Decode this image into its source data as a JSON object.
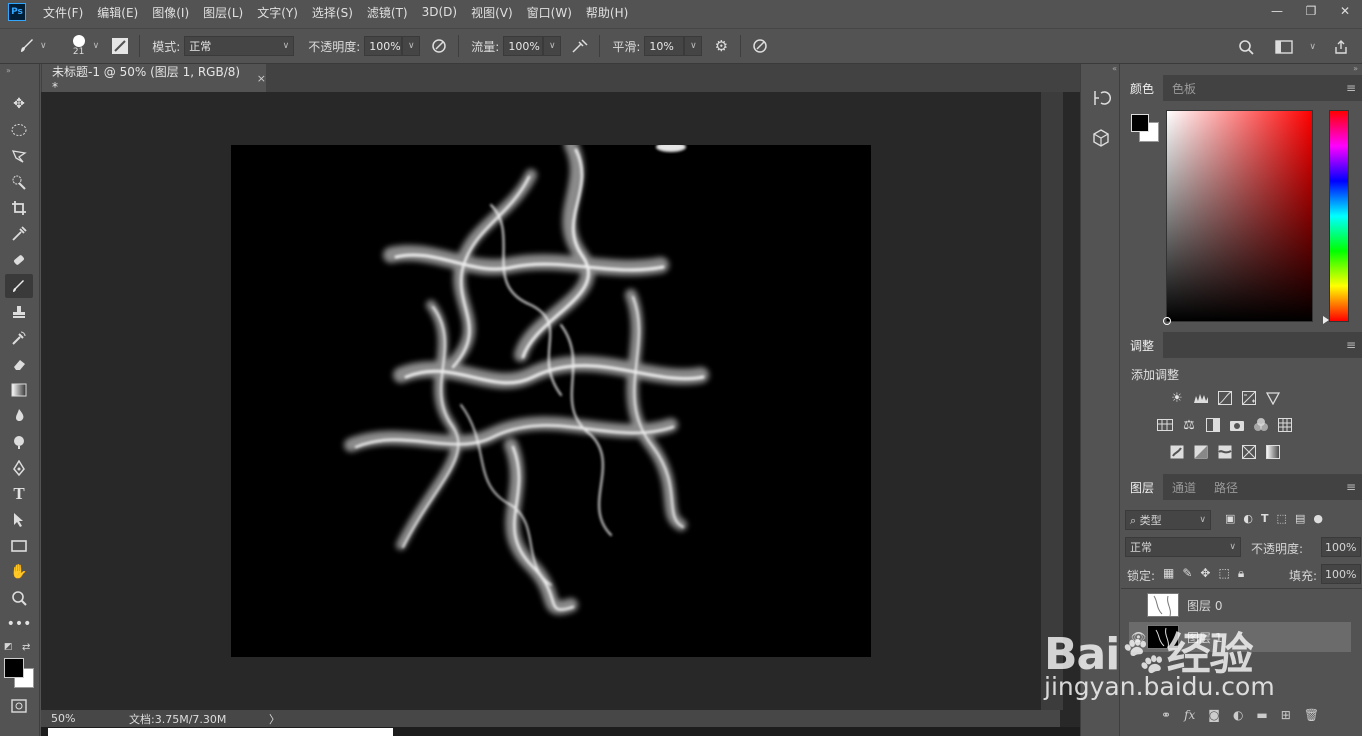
{
  "app": {
    "logo": "Ps"
  },
  "menu": [
    "文件(F)",
    "编辑(E)",
    "图像(I)",
    "图层(L)",
    "文字(Y)",
    "选择(S)",
    "滤镜(T)",
    "3D(D)",
    "视图(V)",
    "窗口(W)",
    "帮助(H)"
  ],
  "window_controls": {
    "minimize": "—",
    "restore": "❐",
    "close": "✕"
  },
  "options": {
    "brush_size": "21",
    "mode_label": "模式:",
    "mode_value": "正常",
    "opacity_label": "不透明度:",
    "opacity_value": "100%",
    "flow_label": "流量:",
    "flow_value": "100%",
    "smoothing_label": "平滑:",
    "smoothing_value": "10%"
  },
  "document": {
    "tab_title": "未标题-1 @ 50% (图层 1, RGB/8) *",
    "tab_close": "×",
    "zoom": "50%",
    "doc_info": "文档:3.75M/7.30M",
    "doc_info_arrow": "〉"
  },
  "panels": {
    "color": {
      "tabs": [
        "颜色",
        "色板"
      ]
    },
    "adjustments": {
      "tab": "调整",
      "add_label": "添加调整"
    },
    "layers": {
      "tabs": [
        "图层",
        "通道",
        "路径"
      ],
      "filter_kind": "类型",
      "blend_mode": "正常",
      "opacity_label": "不透明度:",
      "opacity_value": "100%",
      "lock_label": "锁定:",
      "fill_label": "填充:",
      "fill_value": "100%",
      "layers": [
        {
          "name": "图层 0",
          "visible": false
        },
        {
          "name": "图层 1",
          "visible": true,
          "selected": true
        }
      ]
    }
  },
  "watermark": {
    "brand": "Bai",
    "brand_tail": "经验",
    "url": "jingyan.baidu.com"
  },
  "colors": {
    "foreground": "#000000",
    "background": "#ffffff",
    "accent": "#31a8ff"
  }
}
